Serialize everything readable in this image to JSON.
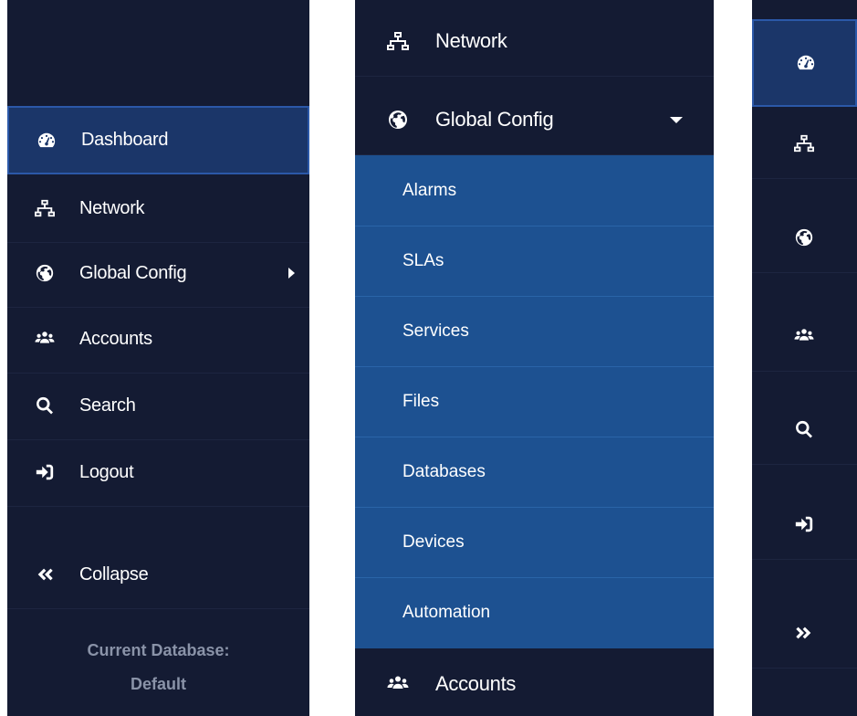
{
  "expanded_sidebar": {
    "items": [
      {
        "label": "Dashboard",
        "icon": "dashboard-icon",
        "active": true
      },
      {
        "label": "Network",
        "icon": "network-icon"
      },
      {
        "label": "Global Config",
        "icon": "globe-icon",
        "has_submenu": true
      },
      {
        "label": "Accounts",
        "icon": "users-icon"
      },
      {
        "label": "Search",
        "icon": "search-icon"
      },
      {
        "label": "Logout",
        "icon": "logout-icon"
      }
    ],
    "collapse_label": "Collapse",
    "collapse_icon": "double-chevron-left-icon",
    "footer_title": "Current Database:",
    "footer_value": "Default"
  },
  "submenu_sidebar": {
    "network_label": "Network",
    "global_config_label": "Global Config",
    "submenu_items": [
      "Alarms",
      "SLAs",
      "Services",
      "Files",
      "Databases",
      "Devices",
      "Automation"
    ],
    "accounts_label": "Accounts"
  },
  "collapsed_sidebar": {
    "icons": [
      "dashboard-icon",
      "network-icon",
      "globe-icon",
      "users-icon",
      "search-icon",
      "logout-icon",
      "double-chevron-right-icon"
    ]
  },
  "colors": {
    "sidebar_bg": "#141b33",
    "active_bg": "#1b3669",
    "active_border": "#2b58a8",
    "submenu_bg": "#1d5191",
    "footer_text": "#8a93a8"
  }
}
